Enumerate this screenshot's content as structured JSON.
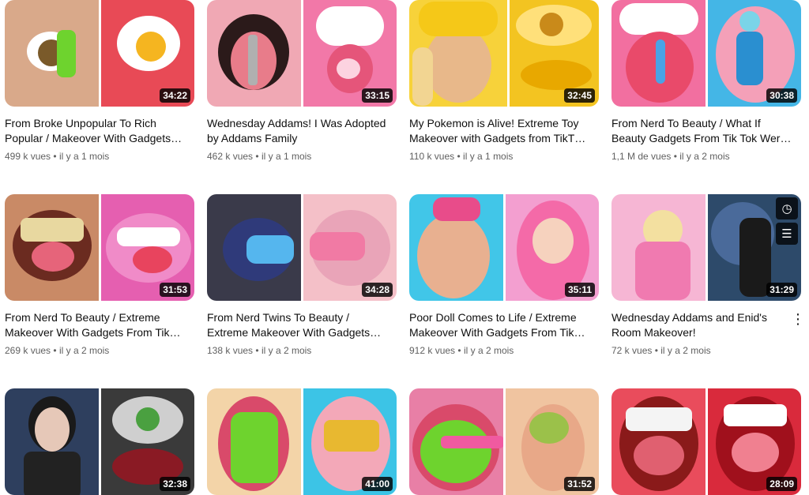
{
  "videos": [
    {
      "title": "From Broke Unpopular To Rich Popular / Makeover With Gadgets…",
      "views": "499 k vues",
      "age": "il y a 1 mois",
      "duration": "34:22"
    },
    {
      "title": "Wednesday Addams! I Was Adopted by Addams Family",
      "views": "462 k vues",
      "age": "il y a 1 mois",
      "duration": "33:15"
    },
    {
      "title": "My Pokemon is Alive! Extreme Toy Makeover with Gadgets from TikT…",
      "views": "110 k vues",
      "age": "il y a 1 mois",
      "duration": "32:45"
    },
    {
      "title": "From Nerd To Beauty / What If Beauty Gadgets From Tik Tok Wer…",
      "views": "1,1 M de vues",
      "age": "il y a 2 mois",
      "duration": "30:38"
    },
    {
      "title": "From Nerd To Beauty / Extreme Makeover With Gadgets From Tik…",
      "views": "269 k vues",
      "age": "il y a 2 mois",
      "duration": "31:53"
    },
    {
      "title": "From Nerd Twins To Beauty / Extreme Makeover With Gadgets…",
      "views": "138 k vues",
      "age": "il y a 2 mois",
      "duration": "34:28"
    },
    {
      "title": "Poor Doll Comes to Life / Extreme Makeover With Gadgets From Tik…",
      "views": "912 k vues",
      "age": "il y a 2 mois",
      "duration": "35:11"
    },
    {
      "title": "Wednesday Addams and Enid's Room Makeover!",
      "views": "72 k vues",
      "age": "il y a 2 mois",
      "duration": "31:29"
    },
    {
      "title": "",
      "views": "",
      "age": "",
      "duration": "32:38"
    },
    {
      "title": "",
      "views": "",
      "age": "",
      "duration": "41:00"
    },
    {
      "title": "",
      "views": "",
      "age": "",
      "duration": "31:52"
    },
    {
      "title": "",
      "views": "",
      "age": "",
      "duration": "28:09"
    }
  ],
  "separator": "•",
  "thumb_colors": [
    [
      "#d9a98a",
      "#e84a56"
    ],
    [
      "#f0a8b4",
      "#f278a8"
    ],
    [
      "#f7d23a",
      "#f3c421"
    ],
    [
      "#f26fa0",
      "#44b6e6"
    ],
    [
      "#c98a66",
      "#e55fb0"
    ],
    [
      "#e9a4b8",
      "#f4c0c8"
    ],
    [
      "#41c6e8",
      "#f39fd0"
    ],
    [
      "#f6b6d4",
      "#2d4a6a"
    ],
    [
      "#2e3f5e",
      "#3a3a3a"
    ],
    [
      "#f3d4a8",
      "#3cc4e6"
    ],
    [
      "#e87fa6",
      "#f0c4a0"
    ],
    [
      "#e94c5c",
      "#d92a3c"
    ]
  ]
}
